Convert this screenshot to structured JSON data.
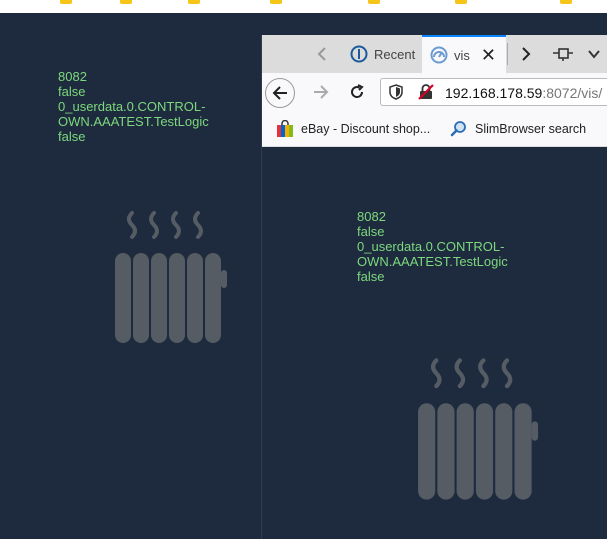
{
  "left_panel": {
    "lines": [
      "8082",
      "false",
      "0_userdata.0.CONTROL-",
      "OWN.AAATEST.TestLogic",
      "false"
    ]
  },
  "browser": {
    "tabs": [
      {
        "label": "Recent",
        "active": false
      },
      {
        "label": "vis",
        "active": true
      }
    ],
    "url": {
      "host": "192.168.178.59",
      "rest": ":8072/vis/"
    },
    "bookmarks": [
      {
        "label": "eBay - Discount shop...",
        "icon": "ebay-bag-icon"
      },
      {
        "label": "SlimBrowser search",
        "icon": "search-icon"
      }
    ],
    "content_lines": [
      "8082",
      "false",
      "0_userdata.0.CONTROL-",
      "OWN.AAATEST.TestLogic",
      "false"
    ]
  },
  "colors": {
    "background": "#1e2b3f",
    "text_green": "#7dd87d",
    "heater_gray": "#555c63",
    "tab_accent": "#0a84ff"
  }
}
